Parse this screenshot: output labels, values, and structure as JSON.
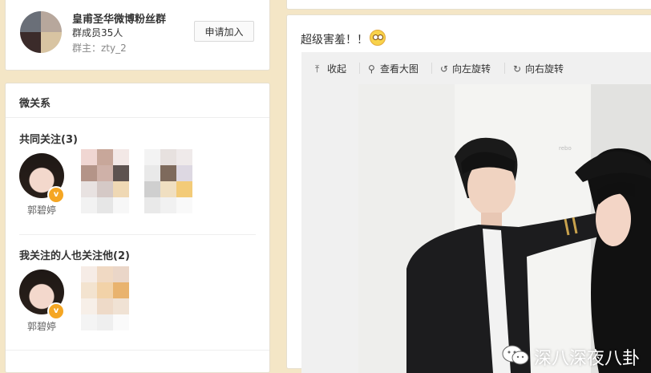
{
  "group": {
    "name": "皇甫圣华微博粉丝群",
    "members": "群成员35人",
    "owner": "群主：zty_2",
    "join_label": "申请加入"
  },
  "relations": {
    "title": "微关系",
    "common_follow": {
      "title": "共同关注(3)",
      "people": [
        {
          "name": "郭碧婷",
          "verified": "v"
        }
      ]
    },
    "also_follow": {
      "title": "我关注的人也关注他(2)",
      "people": [
        {
          "name": "郭碧婷",
          "verified": "v"
        }
      ]
    }
  },
  "post": {
    "text": "超级害羞！！",
    "emoji": "shy-emoji",
    "toolbar": {
      "collapse": "收起",
      "view_large": "查看大图",
      "rotate_left": "向左旋转",
      "rotate_right": "向右旋转"
    },
    "watermark": "深八深夜八卦",
    "wall_tag": "rebo"
  },
  "colors": {
    "page_bg": "#f4e6c6",
    "badge": "#f5a623"
  }
}
